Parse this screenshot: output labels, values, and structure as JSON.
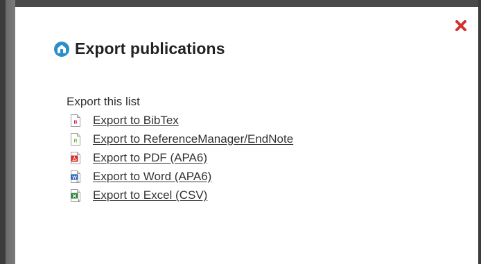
{
  "modal": {
    "title": "Export publications",
    "section_label": "Export this list",
    "exports": [
      {
        "label": "Export to BibTex",
        "icon": "bibtex-file-icon",
        "letter": "B",
        "color": "#d81b60"
      },
      {
        "label": "Export to ReferenceManager/EndNote",
        "icon": "endnote-file-icon",
        "letter": "R",
        "color": "#7cb342"
      },
      {
        "label": "Export to PDF (APA6)",
        "icon": "pdf-file-icon",
        "letter": "",
        "color": "#d32f2f"
      },
      {
        "label": "Export to Word (APA6)",
        "icon": "word-file-icon",
        "letter": "W",
        "color": "#1e5ab5"
      },
      {
        "label": "Export to Excel (CSV)",
        "icon": "excel-file-icon",
        "letter": "X",
        "color": "#2e7d32"
      }
    ]
  },
  "colors": {
    "close": "#d32f2f",
    "header_icon": "#2b8fc9"
  }
}
